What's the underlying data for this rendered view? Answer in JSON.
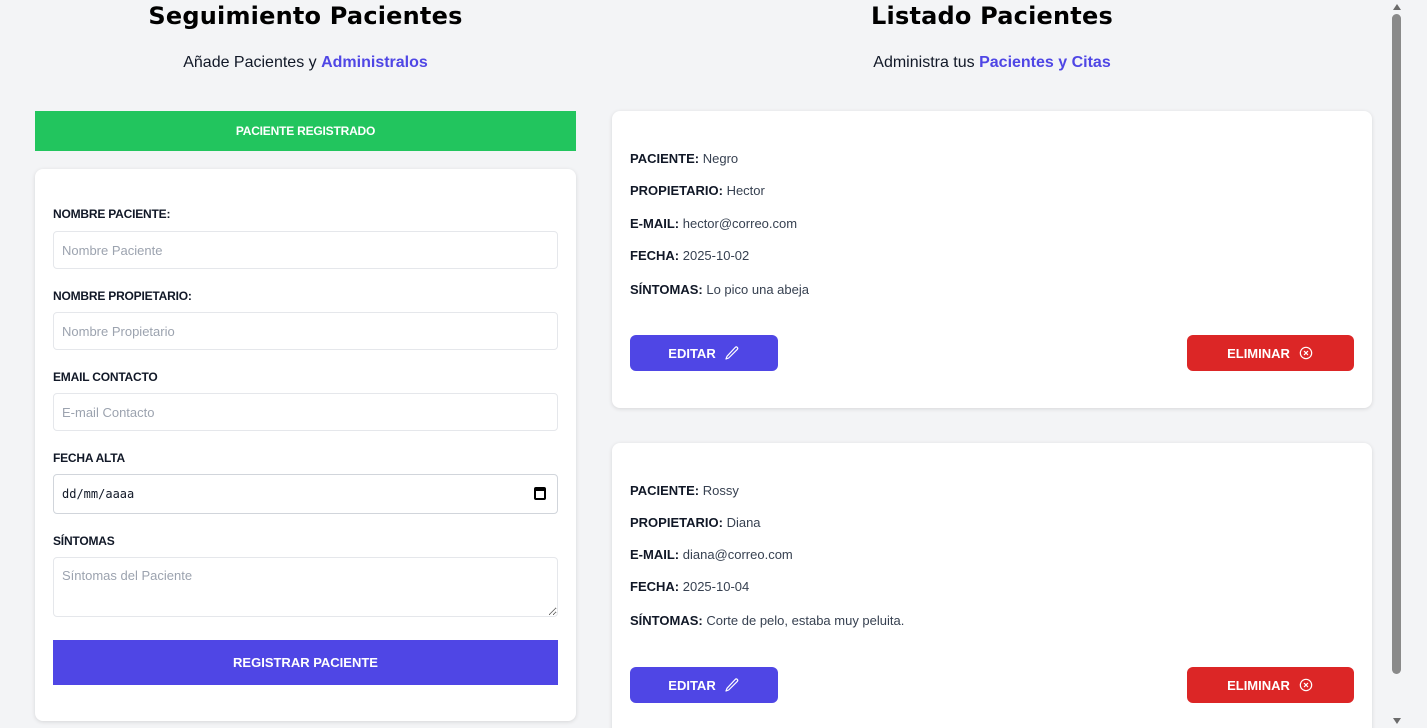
{
  "left": {
    "title": "Seguimiento Pacientes",
    "subtitle_prefix": "Añade Pacientes y ",
    "subtitle_accent": "Administralos",
    "alert": "PACIENTE REGISTRADO",
    "form": {
      "patient_label": "Nombre Paciente:",
      "patient_placeholder": "Nombre Paciente",
      "owner_label": "Nombre Propietario:",
      "owner_placeholder": "Nombre Propietario",
      "email_label": "Email Contacto",
      "email_placeholder": "E-mail Contacto",
      "date_label": "Fecha Alta",
      "date_value": "dd/mm/aaaa",
      "symptoms_label": "Síntomas",
      "symptoms_placeholder": "Síntomas del Paciente",
      "submit_label": "Registrar Paciente"
    }
  },
  "right": {
    "title": "Listado Pacientes",
    "subtitle_prefix": "Administra tus ",
    "subtitle_accent": "Pacientes y Citas",
    "field_labels": {
      "patient": "Paciente:",
      "owner": "Propietario:",
      "email": "E-mail:",
      "date": "Fecha:",
      "symptoms": "Síntomas:"
    },
    "patients": [
      {
        "patient": "Negro",
        "owner": "Hector",
        "email": "hector@correo.com",
        "date": "2025-10-02",
        "symptoms": "Lo pico una abeja",
        "edit_label": "Editar",
        "delete_label": "Eliminar"
      },
      {
        "patient": "Rossy",
        "owner": "Diana",
        "email": "diana@correo.com",
        "date": "2025-10-04",
        "symptoms": "Corte de pelo, estaba muy peluita.",
        "edit_label": "Editar",
        "delete_label": "Eliminar"
      }
    ]
  },
  "colors": {
    "accent": "#4f46e5",
    "success": "#22c55e",
    "danger": "#dc2626",
    "background": "#f3f4f6"
  },
  "icons": {
    "edit": "pencil-icon",
    "delete": "x-circle-icon",
    "calendar": "calendar-icon"
  }
}
